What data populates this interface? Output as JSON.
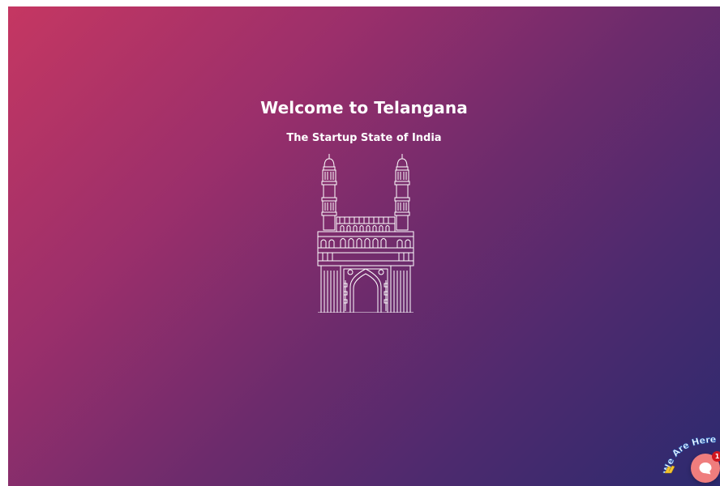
{
  "hero": {
    "title": "Welcome to Telangana",
    "subtitle": "The Startup State of India",
    "illustration": "charminar-line-art"
  },
  "chat_widget": {
    "label": "We Are Here",
    "badge_count": "1",
    "icon": "chat-bubble-icon",
    "wave_icon": "waving-hand-icon",
    "button_color": "#ef7d7d",
    "badge_color": "#d0161f"
  },
  "colors": {
    "gradient_start": "#c53762",
    "gradient_end": "#2c2a6f",
    "text": "#ffffff"
  }
}
